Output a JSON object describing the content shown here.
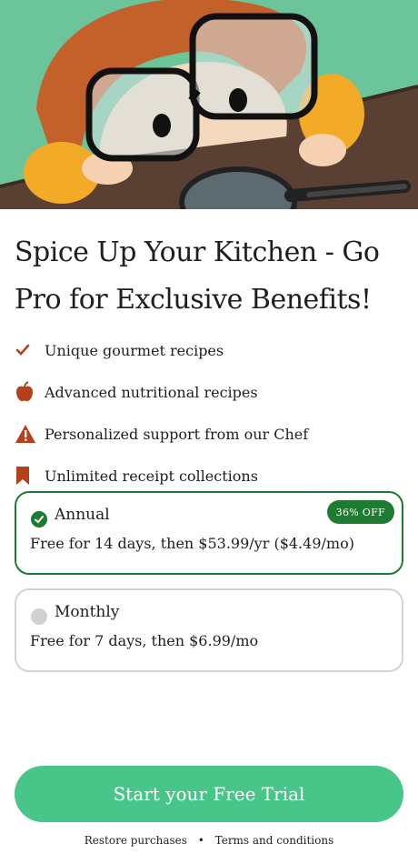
{
  "hero": {
    "image_alt": "cartoon child with glasses peeking over table with magnifying glass"
  },
  "title": "Spice Up Your Kitchen - Go Pro for Exclusive Benefits!",
  "features": [
    {
      "icon": "check-icon",
      "label": "Unique gourmet recipes"
    },
    {
      "icon": "apple-icon",
      "label": "Advanced nutritional recipes"
    },
    {
      "icon": "warning-icon",
      "label": "Personalized support from our Chef"
    },
    {
      "icon": "bookmark-icon",
      "label": "Unlimited receipt collections"
    }
  ],
  "plans": {
    "annual": {
      "name": "Annual",
      "description": "Free for 14 days, then $53.99/yr ($4.49/mo)",
      "badge": "36% OFF",
      "selected": true
    },
    "monthly": {
      "name": "Monthly",
      "description": "Free for 7 days, then $6.99/mo",
      "selected": false
    }
  },
  "cta": {
    "label": "Start your Free Trial"
  },
  "footer": {
    "restore": "Restore purchases",
    "separator": "•",
    "terms": "Terms and conditions"
  },
  "colors": {
    "accent_green": "#1f7a32",
    "cta_green": "#48c689",
    "icon_orange": "#b5401c"
  }
}
